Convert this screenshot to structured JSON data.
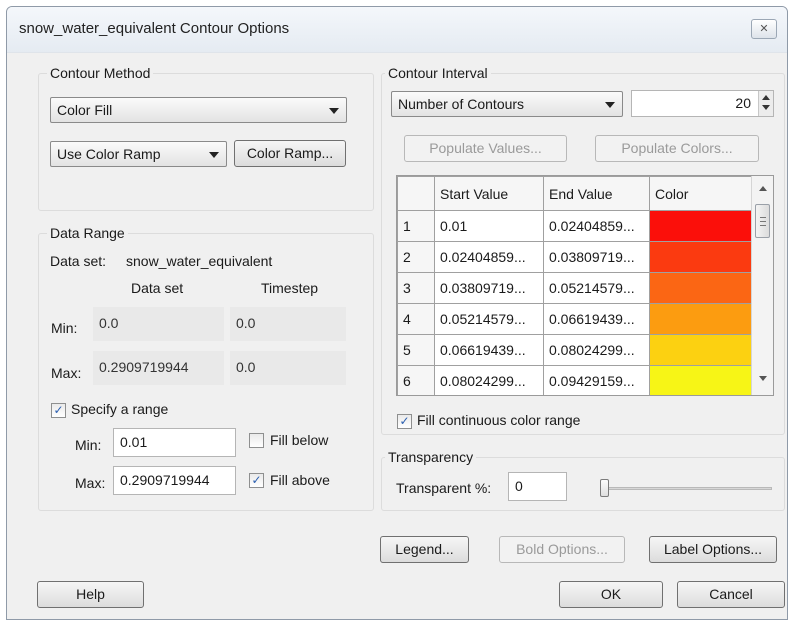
{
  "window": {
    "title": "snow_water_equivalent Contour Options",
    "close_icon": "close-icon"
  },
  "contour_method": {
    "group_label": "Contour Method",
    "method_selected": "Color Fill",
    "ramp_mode_selected": "Use Color Ramp",
    "color_ramp_button": "Color Ramp..."
  },
  "data_range": {
    "group_label": "Data Range",
    "dataset_label": "Data set:",
    "dataset_name": "snow_water_equivalent",
    "col_dataset": "Data set",
    "col_timestep": "Timestep",
    "min_label": "Min:",
    "max_label": "Max:",
    "dataset_min": "0.0",
    "dataset_max": "0.2909719944",
    "timestep_min": "0.0",
    "timestep_max": "0.0",
    "specify_range_label": "Specify a range",
    "specify_range_checked": true,
    "range_min_label": "Min:",
    "range_max_label": "Max:",
    "range_min": "0.01",
    "range_max": "0.2909719944",
    "fill_below_label": "Fill below",
    "fill_below_checked": false,
    "fill_above_label": "Fill above",
    "fill_above_checked": true
  },
  "contour_interval": {
    "group_label": "Contour Interval",
    "mode_selected": "Number of Contours",
    "count": "20",
    "populate_values_button": "Populate Values...",
    "populate_colors_button": "Populate Colors...",
    "table": {
      "headers": [
        "",
        "Start Value",
        "End Value",
        "Color"
      ],
      "rows": [
        {
          "n": "1",
          "start": "0.01",
          "end": "0.02404859...",
          "color": "#fb0f0a"
        },
        {
          "n": "2",
          "start": "0.02404859...",
          "end": "0.03809719...",
          "color": "#fb3a10"
        },
        {
          "n": "3",
          "start": "0.03809719...",
          "end": "0.05214579...",
          "color": "#fb6614"
        },
        {
          "n": "4",
          "start": "0.05214579...",
          "end": "0.06619439...",
          "color": "#fc9c10"
        },
        {
          "n": "5",
          "start": "0.06619439...",
          "end": "0.08024299...",
          "color": "#fcd111"
        },
        {
          "n": "6",
          "start": "0.08024299...",
          "end": "0.09429159...",
          "color": "#f7f516"
        }
      ]
    },
    "fill_continuous_label": "Fill continuous color range",
    "fill_continuous_checked": true
  },
  "transparency": {
    "group_label": "Transparency",
    "percent_label": "Transparent %:",
    "value": "0",
    "slider_fraction": 0
  },
  "buttons": {
    "legend": "Legend...",
    "bold_options": "Bold Options...",
    "label_options": "Label Options...",
    "help": "Help",
    "ok": "OK",
    "cancel": "Cancel"
  }
}
